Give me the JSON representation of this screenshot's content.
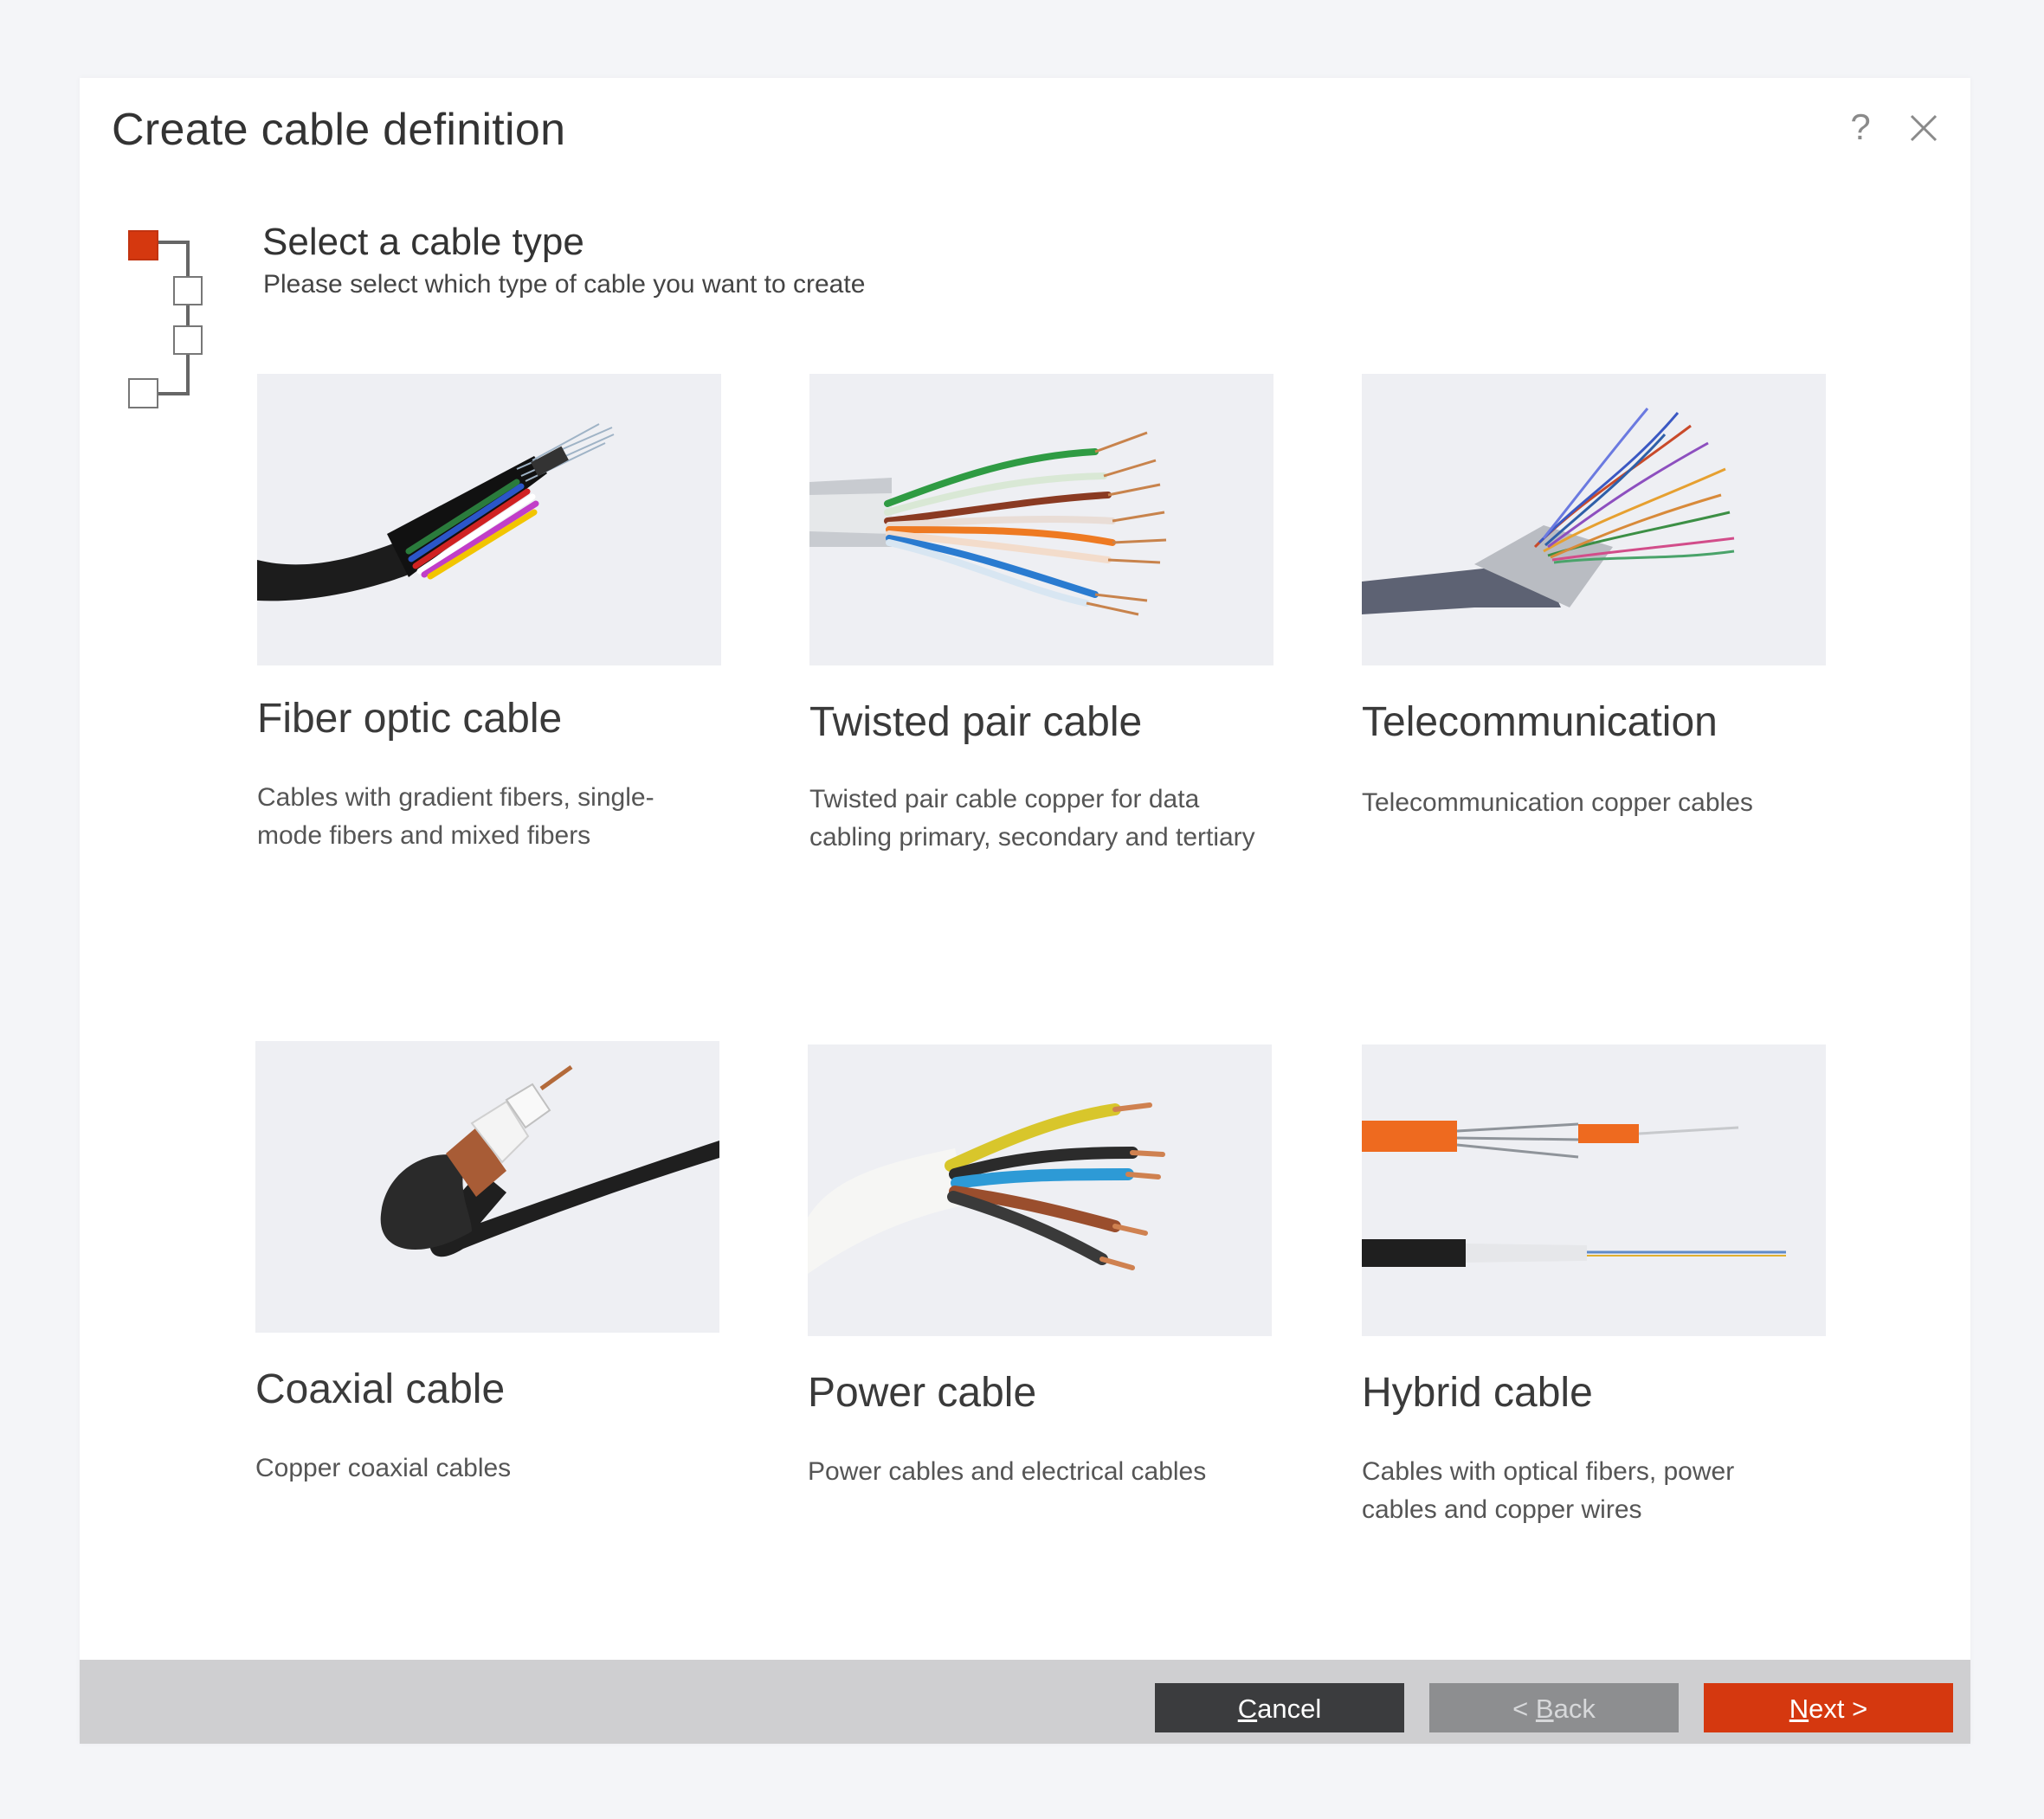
{
  "dialog": {
    "title": "Create cable definition",
    "help_glyph": "?",
    "close_glyph": "×"
  },
  "step": {
    "title": "Select a cable type",
    "subtitle": "Please select which type of cable you want to create",
    "current": 1,
    "total": 4
  },
  "cards": [
    {
      "name": "Fiber optic cable",
      "description": "Cables with gradient fibers, single-mode fibers and mixed fibers",
      "icon": "fiber-optic-cable-image"
    },
    {
      "name": "Twisted pair cable",
      "description": "Twisted pair cable copper for data cabling primary, secondary and tertiary",
      "icon": "twisted-pair-cable-image"
    },
    {
      "name": "Telecommunication",
      "description": "Telecommunication copper cables",
      "icon": "telecommunication-cable-image"
    },
    {
      "name": "Coaxial cable",
      "description": "Copper coaxial cables",
      "icon": "coaxial-cable-image"
    },
    {
      "name": "Power cable",
      "description": "Power cables and electrical cables",
      "icon": "power-cable-image"
    },
    {
      "name": "Hybrid cable",
      "description": "Cables with optical fibers, power cables and copper wires",
      "icon": "hybrid-cable-image"
    }
  ],
  "footer": {
    "cancel": {
      "first": "C",
      "rest": "ancel"
    },
    "back": {
      "prefix": "< ",
      "first": "B",
      "rest": "ack"
    },
    "next": {
      "first": "N",
      "rest": "ext",
      "suffix": " >"
    }
  },
  "colors": {
    "accent": "#d5380f",
    "cancel_bg": "#3b3c3e",
    "back_bg": "#8d8e90",
    "footer_bg": "#cfcfd1"
  }
}
